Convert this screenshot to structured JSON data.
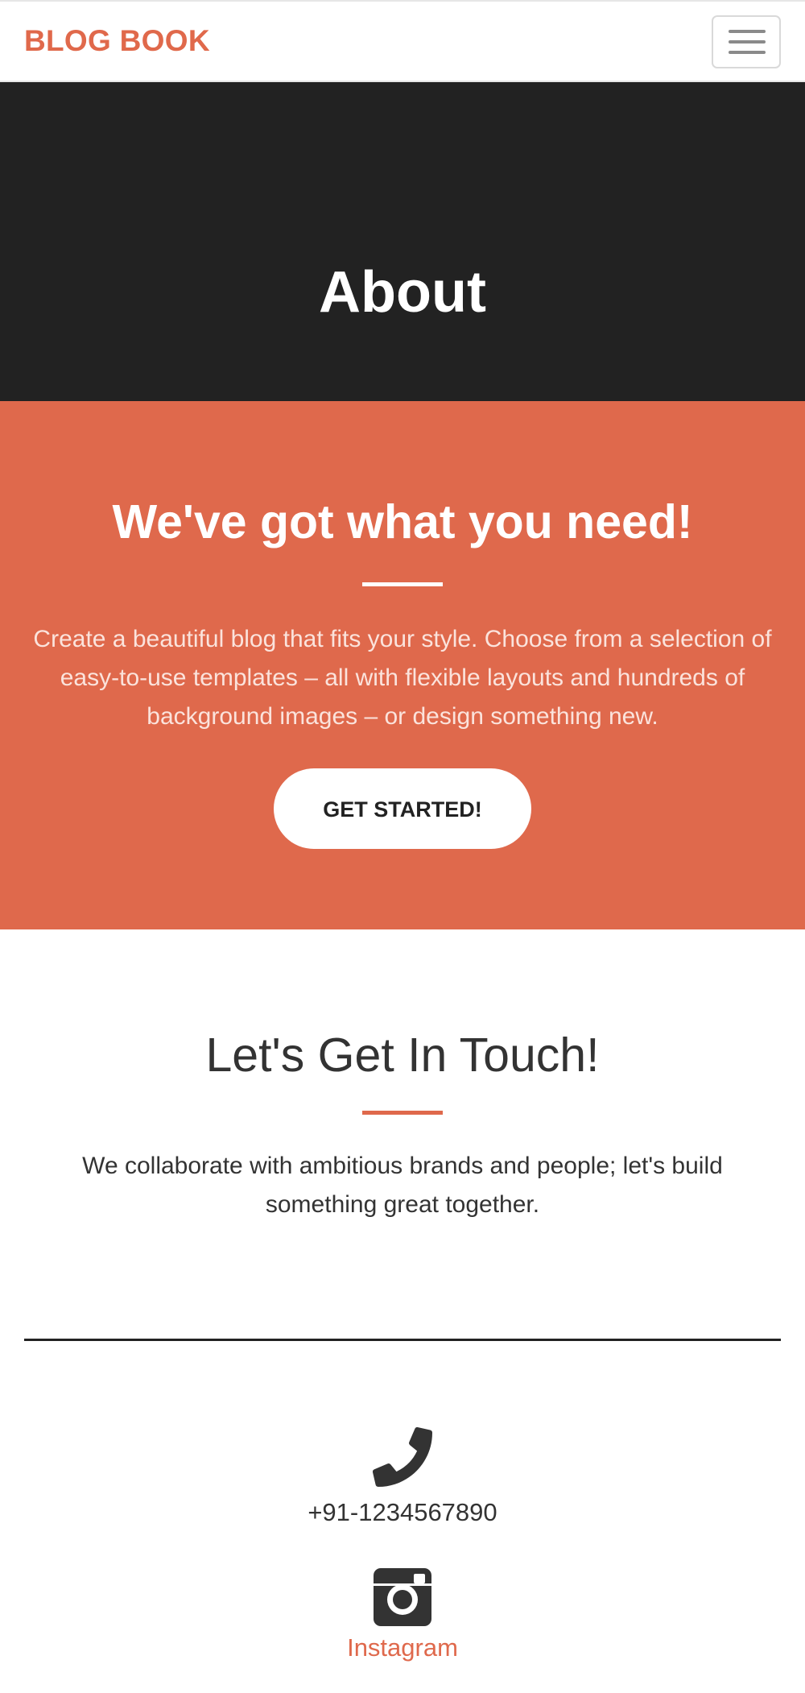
{
  "navbar": {
    "brand": "BLOG BOOK",
    "menu_icon": "hamburger-menu-icon"
  },
  "hero": {
    "title": "About"
  },
  "promo": {
    "heading": "We've got what you need!",
    "text": "Create a beautiful blog that fits your style. Choose from a selection of easy-to-use templates – all with flexible layouts and hundreds of background images – or design something new.",
    "button_label": "GET STARTED!"
  },
  "contact": {
    "heading": "Let's Get In Touch!",
    "text": "We collaborate with ambitious brands and people; let's build something great together.",
    "phone_icon": "phone-icon",
    "phone": "+91-1234567890",
    "instagram_icon": "instagram-icon",
    "instagram_label": "Instagram"
  },
  "colors": {
    "accent": "#df694c",
    "dark": "#222222",
    "white": "#ffffff"
  }
}
